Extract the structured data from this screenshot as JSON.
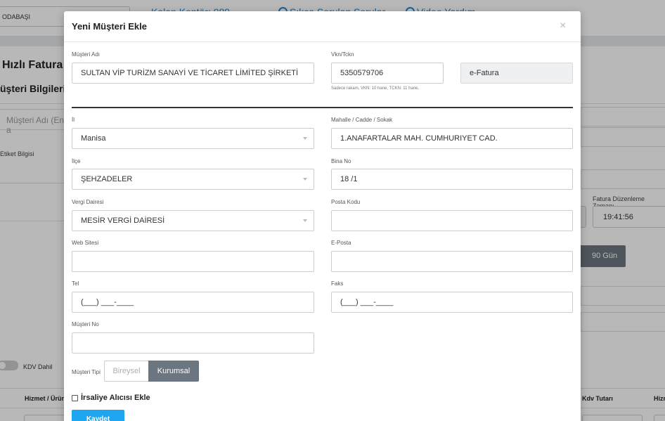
{
  "background": {
    "topbar": {
      "select_value": "ODABAŞI",
      "links": [
        "Kalan Kontör: 989",
        "Sıkça Sorulan Sorular",
        "Video Yardım"
      ]
    },
    "title": "Hızlı Fatura",
    "subtitle": "üşteri Bilgileri",
    "customer_input_placeholder": "Müşteri Adı (En a",
    "etiket_label": "Etiket Bilgisi",
    "kdv_label": "KDV Dahil",
    "fatura_zamani_label": "Fatura Düzenleme Zamanı",
    "fatura_zamani_value": "19:41:56",
    "days_button": "90 Gün",
    "table_headers": [
      "Hizmet / Ürün",
      "Kdv Tutarı",
      "Hizm"
    ]
  },
  "modal": {
    "title": "Yeni Müşteri Ekle",
    "close_label": "×",
    "fields": {
      "musteri_adi": {
        "label": "Müşteri Adı",
        "value": "SULTAN VİP TURİZM SANAYİ VE TİCARET LİMİTED ŞİRKETİ"
      },
      "vkn": {
        "label": "Vkn/Tckn",
        "value": "5350579706",
        "hint": "Sadece rakam, VKN: 10 hane, TCKN: 11 hane."
      },
      "fatura_tipi": {
        "value": "e-Fatura"
      },
      "il": {
        "label": "İl",
        "value": "Manisa"
      },
      "mahalle": {
        "label": "Mahalle / Cadde / Sokak",
        "value": "1.ANAFARTALAR MAH. CUMHURIYET CAD."
      },
      "ilce": {
        "label": "İlçe",
        "value": "ŞEHZADELER"
      },
      "bina_no": {
        "label": "Bina No",
        "value": "18 /1"
      },
      "vergi_dairesi": {
        "label": "Vergi Dairesi",
        "value": "MESİR VERGİ DAİRESİ"
      },
      "posta_kodu": {
        "label": "Posta Kodu",
        "value": ""
      },
      "web_sitesi": {
        "label": "Web Sitesi",
        "value": ""
      },
      "eposta": {
        "label": "E-Posta",
        "value": ""
      },
      "tel": {
        "label": "Tel",
        "value": "(___) ___-____"
      },
      "faks": {
        "label": "Faks",
        "value": "(___) ___-____"
      },
      "musteri_no": {
        "label": "Müşteri No",
        "value": ""
      }
    },
    "musteri_tipi": {
      "label": "Müşteri Tipi",
      "options": [
        "Bireysel",
        "Kurumsal"
      ],
      "selected": "Kurumsal"
    },
    "irsaliye_label": "İrsaliye Alıcısı Ekle",
    "save_label": "Kaydet"
  },
  "colors": {
    "primary": "#1ea7f0",
    "segment_active": "#6c7680",
    "link": "#1f8ad6"
  }
}
